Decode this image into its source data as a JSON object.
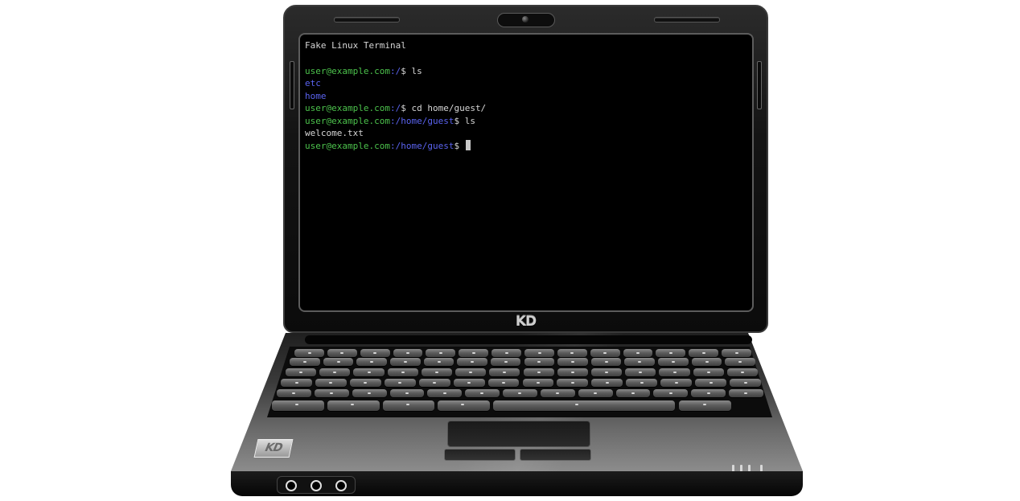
{
  "terminal": {
    "title": "Fake Linux Terminal",
    "lines": [
      {
        "user": "user@example.com",
        "path": ":/",
        "prompt": "$ ",
        "command": "ls"
      },
      {
        "output": "etc"
      },
      {
        "output": "home"
      },
      {
        "user": "user@example.com",
        "path": ":/",
        "prompt": "$ ",
        "command": "cd home/guest/"
      },
      {
        "user": "user@example.com",
        "path": ":/home/guest",
        "prompt": "$ ",
        "command": "ls"
      },
      {
        "output": "welcome.txt"
      },
      {
        "user": "user@example.com",
        "path": ":/home/guest",
        "prompt": "$ ",
        "command": ""
      }
    ]
  },
  "laptop": {
    "lid_logo": "KD",
    "base_badge": "KD"
  },
  "colors": {
    "user": "#4cc24c",
    "path": "#5a63ef",
    "text": "#d6d6d6",
    "screen_bg": "#000000"
  },
  "icons": [
    "webcam-icon",
    "audio-jack-icon",
    "status-light-icon"
  ]
}
